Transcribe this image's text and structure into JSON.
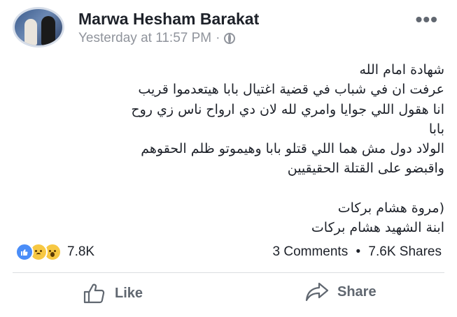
{
  "post": {
    "author_name": "Marwa Hesham Barakat",
    "timestamp": "Yesterday at 11:57 PM",
    "meta_separator": "·",
    "privacy_icon": "globe-icon",
    "more_label": "•••",
    "body_lines": [
      "شهادة امام الله",
      "عرفت ان في شباب في قضية اغتيال بابا هيتعدموا قريب",
      "انا هقول اللي جوايا وامري لله لان دي ارواح ناس زي روح",
      "بابا",
      "الولاد دول مش هما اللي قتلو بابا وهيموتو ظلم الحقوهم",
      "واقبضو على القتلة الحقيقيين",
      "",
      "(مروة هشام بركات",
      "ابنة الشهيد هشام بركات"
    ]
  },
  "engagement": {
    "reaction_icons": [
      "like-reaction-icon",
      "sad-reaction-icon",
      "wow-reaction-icon"
    ],
    "reaction_count": "7.8K",
    "comments": "3 Comments",
    "separator": "•",
    "shares": "7.6K Shares"
  },
  "actions": {
    "like_label": "Like",
    "share_label": "Share"
  },
  "colors": {
    "text_primary": "#1d2129",
    "text_secondary": "#90949c",
    "action_gray": "#606770",
    "like_blue": "#4a8df8",
    "reaction_yellow": "#f7c843"
  }
}
